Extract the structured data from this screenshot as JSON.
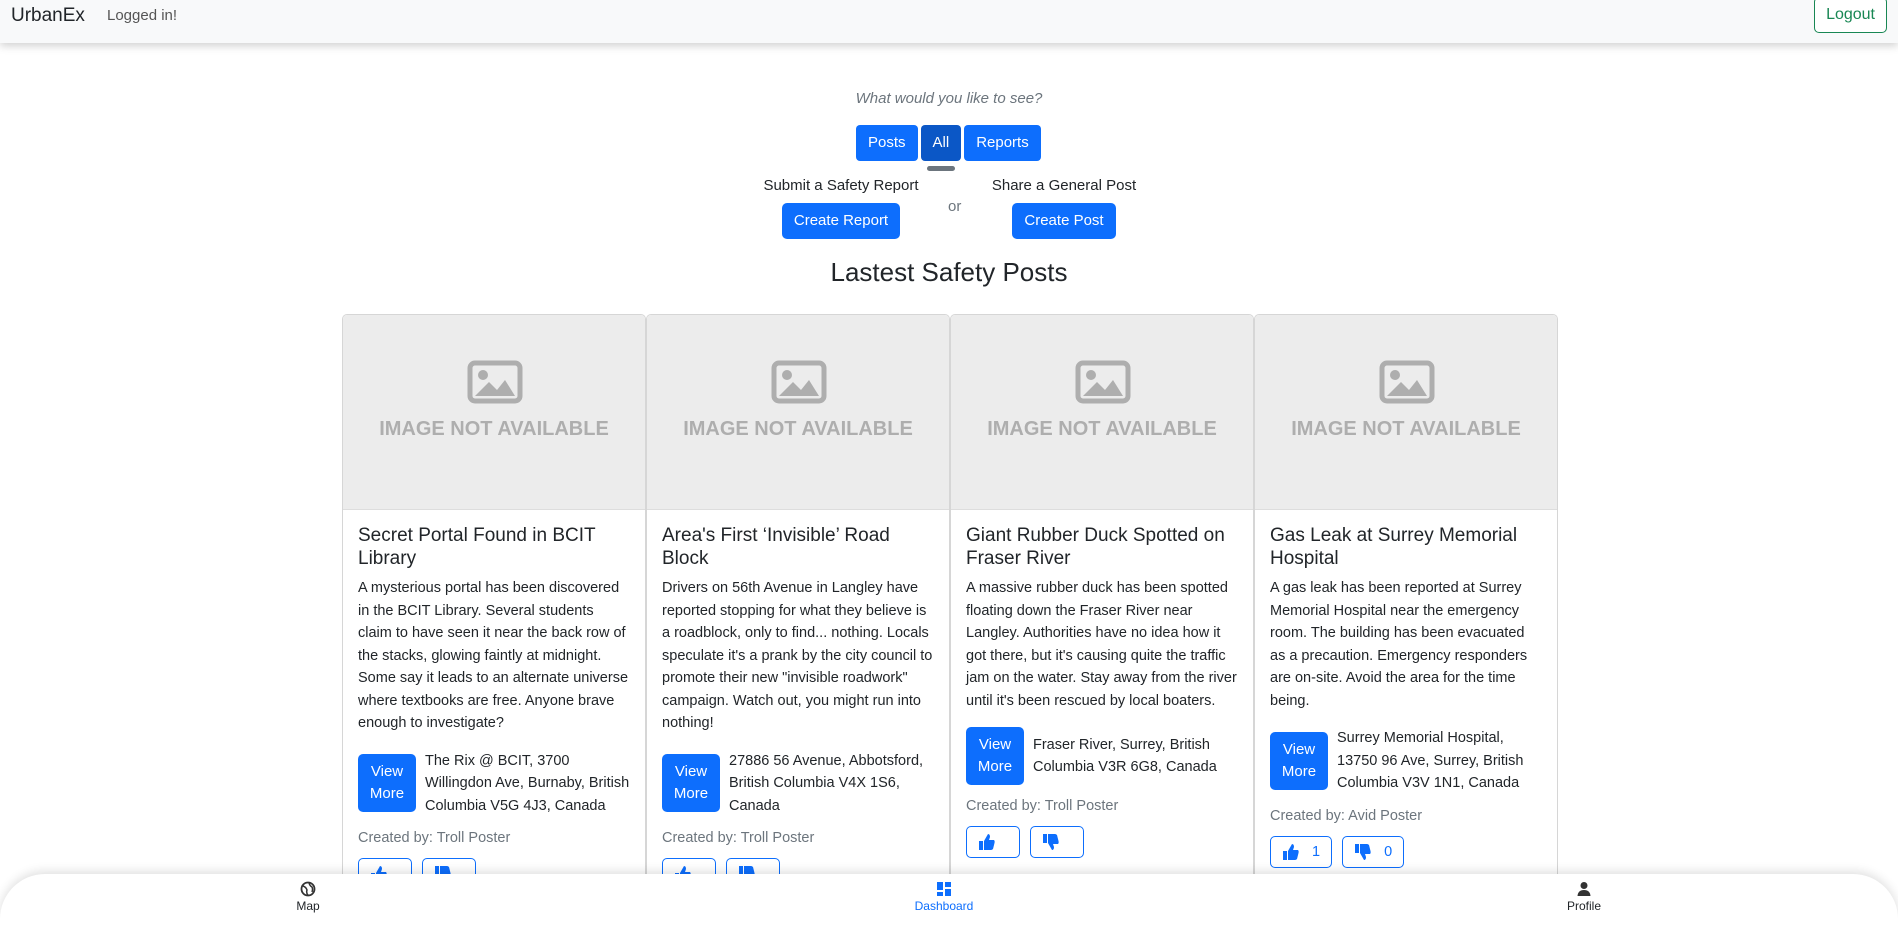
{
  "navbar": {
    "brand": "UrbanEx",
    "status": "Logged in!",
    "logout_label": "Logout"
  },
  "filter": {
    "prompt": "What would you like to see?",
    "options": [
      {
        "label": "Posts",
        "active": false
      },
      {
        "label": "All",
        "active": true
      },
      {
        "label": "Reports",
        "active": false
      }
    ]
  },
  "actions": {
    "report_prompt": "Submit a Safety Report",
    "report_button": "Create Report",
    "or_text": "or",
    "post_prompt": "Share a General Post",
    "post_button": "Create Post"
  },
  "section_title": "Lastest Safety Posts",
  "image_placeholder": "IMAGE NOT AVAILABLE",
  "view_more_label": "View More",
  "posts": [
    {
      "title": "Secret Portal Found in BCIT Library",
      "text": "A mysterious portal has been discovered in the BCIT Library. Several students claim to have seen it near the back row of the stacks, glowing faintly at midnight. Some say it leads to an alternate universe where textbooks are free. Anyone brave enough to investigate?",
      "location": "The Rix @ BCIT, 3700 Willingdon Ave, Burnaby, British Columbia V5G 4J3, Canada",
      "author": "Created by: Troll Poster",
      "likes": "",
      "dislikes": ""
    },
    {
      "title": "Area's First ‘Invisible’ Road Block",
      "text": "Drivers on 56th Avenue in Langley have reported stopping for what they believe is a roadblock, only to find... nothing. Locals speculate it's a prank by the city council to promote their new \"invisible roadwork\" campaign. Watch out, you might run into nothing!",
      "location": "27886 56 Avenue, Abbotsford, British Columbia V4X 1S6, Canada",
      "author": "Created by: Troll Poster",
      "likes": "",
      "dislikes": ""
    },
    {
      "title": "Giant Rubber Duck Spotted on Fraser River",
      "text": "A massive rubber duck has been spotted floating down the Fraser River near Langley. Authorities have no idea how it got there, but it's causing quite the traffic jam on the water. Stay away from the river until it's been rescued by local boaters.",
      "location": "Fraser River, Surrey, British Columbia V3R 6G8, Canada",
      "author": "Created by: Troll Poster",
      "likes": "",
      "dislikes": ""
    },
    {
      "title": "Gas Leak at Surrey Memorial Hospital",
      "text": "A gas leak has been reported at Surrey Memorial Hospital near the emergency room. The building has been evacuated as a precaution. Emergency responders are on-site. Avoid the area for the time being.",
      "location": "Surrey Memorial Hospital, 13750 96 Ave, Surrey, British Columbia V3V 1N1, Canada",
      "author": "Created by: Avid Poster",
      "likes": "1",
      "dislikes": "0"
    }
  ],
  "bottom_nav": [
    {
      "label": "Map",
      "icon": "globe-icon",
      "active": false
    },
    {
      "label": "Dashboard",
      "icon": "dashboard-icon",
      "active": true
    },
    {
      "label": "Profile",
      "icon": "person-icon",
      "active": false
    }
  ],
  "colors": {
    "primary": "#0d6efd",
    "success": "#198754",
    "muted": "#6c757d"
  }
}
